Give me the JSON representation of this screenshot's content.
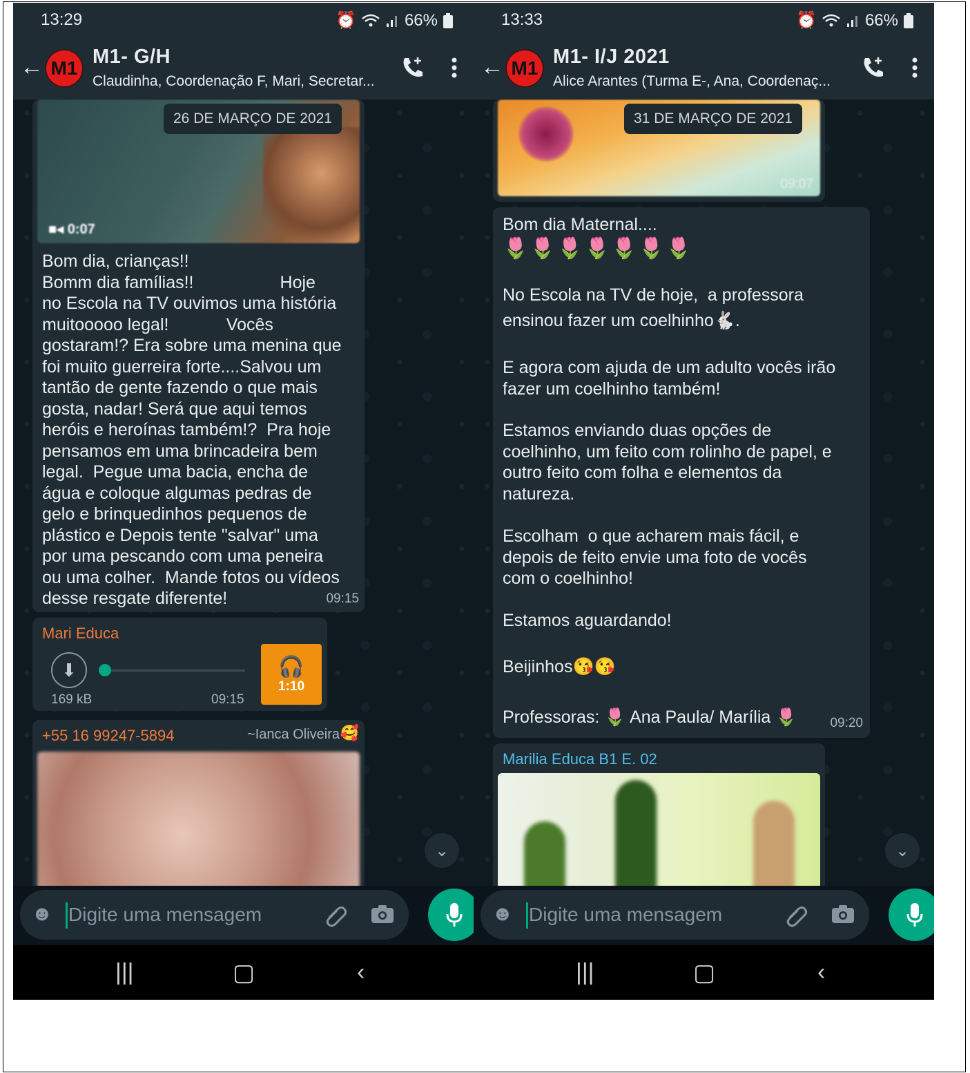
{
  "left": {
    "status": {
      "time": "13:29",
      "battery": "66%"
    },
    "header": {
      "avatar": "M1",
      "title": "M1- G/H",
      "subtitle": "Claudinha, Coordenação F, Mari, Secretar..."
    },
    "date_chip": "26 DE MARÇO DE 2021",
    "video_duration": "0:07",
    "message1": {
      "text": "Bom dia, crianças!!\nBomm dia famílias!!                  Hoje\nno Escola na TV ouvimos uma história\nmuitooooo legal!            Vocês\ngostaram!? Era sobre uma menina que\nfoi muito guerreira forte....Salvou um\ntantão de gente fazendo o que mais\ngosta, nadar! Será que aqui temos\nheróis e heroínas também!?  Pra hoje\npensamos em uma brincadeira bem\nlegal.  Pegue uma bacia, encha de\nágua e coloque algumas pedras de\ngelo e brinquedinhos pequenos de\nplástico e Depois tente \"salvar\" uma\npor uma pescando com uma peneira\nou uma colher.  Mande fotos ou vídeos\ndesse resgate diferente!",
      "time": "09:15"
    },
    "audio": {
      "sender": "Mari Educa",
      "size": "169 kB",
      "time": "09:15",
      "duration": "1:10"
    },
    "message3": {
      "sender": "+55 16 99247-5894",
      "name": "~Ianca Oliveira"
    },
    "input_placeholder": "Digite uma mensagem"
  },
  "right": {
    "status": {
      "time": "13:33",
      "battery": "66%"
    },
    "header": {
      "avatar": "M1",
      "title": "M1- I/J 2021",
      "subtitle": "Alice Arantes (Turma E-, Ana, Coordenaç..."
    },
    "date_chip": "31 DE MARÇO DE 2021",
    "image_time": "09:07",
    "message": {
      "p1": "Bom dia Maternal....",
      "p2a": "No Escola na TV de hoje,  a professora",
      "p2b": "ensinou fazer um coelhinho",
      "p3": "E agora com ajuda de um adulto vocês irão\nfazer um coelhinho também!",
      "p4": "Estamos enviando duas opções de\ncoelhinho, um feito com rolinho de papel, e\noutro feito com folha e elementos da\nnatureza.",
      "p5": "Escolham  o que acharem mais fácil, e\ndepois de feito envie uma foto de vocês\ncom o coelhinho!",
      "p6": "Estamos aguardando!",
      "p7": "Beijinhos",
      "p8a": "Professoras:",
      "p8b": "Ana Paula/ Marília",
      "time": "09:20"
    },
    "next_sender": "Marilia Educa B1 E. 02",
    "input_placeholder": "Digite uma mensagem"
  },
  "colors": {
    "accent": "#00a884",
    "bg": "#0b141a",
    "bubble": "#1f2c34",
    "sender_orange": "#f0793c",
    "sender_teal": "#53bdeb",
    "audio_orange": "#f0900f"
  }
}
